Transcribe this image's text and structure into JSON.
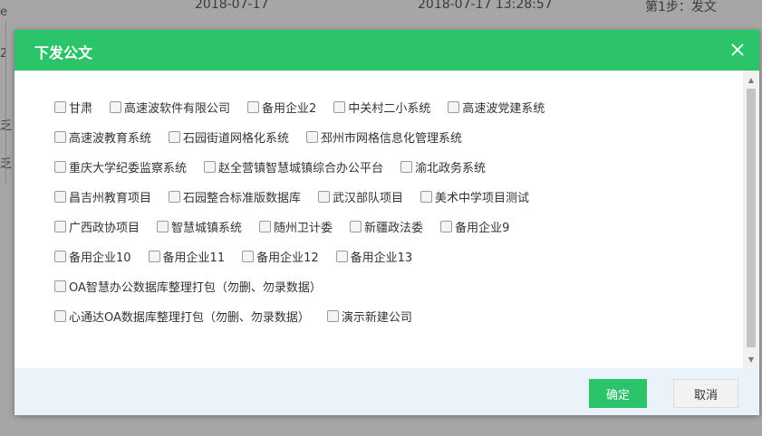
{
  "background": {
    "row": [
      "2018-07-17",
      "2018-07-17 13:28:57",
      "第1步：发文"
    ],
    "left_edge_chars": [
      "e",
      "2",
      "乏",
      "乏"
    ]
  },
  "dialog": {
    "title": "下发公文",
    "confirm_label": "确定",
    "cancel_label": "取消",
    "option_rows": [
      [
        "甘肃",
        "高速波软件有限公司",
        "备用企业2",
        "中关村二小系统",
        "高速波党建系统"
      ],
      [
        "高速波教育系统",
        "石园街道网格化系统",
        "邳州市网格信息化管理系统"
      ],
      [
        "重庆大学纪委监察系统",
        "赵全营镇智慧城镇综合办公平台",
        "渝北政务系统"
      ],
      [
        "昌吉州教育项目",
        "石园整合标准版数据库",
        "武汉部队项目",
        "美术中学项目测试"
      ],
      [
        "广西政协项目",
        "智慧城镇系统",
        "随州卫计委",
        "新疆政法委",
        "备用企业9"
      ],
      [
        "备用企业10",
        "备用企业11",
        "备用企业12",
        "备用企业13"
      ],
      [
        "OA智慧办公数据库整理打包（勿删、勿录数据）"
      ],
      [
        "心通达OA数据库整理打包（勿删、勿录数据）",
        "演示新建公司"
      ]
    ]
  },
  "colors": {
    "accent": "#2bc46b",
    "footer_bg": "#eaf3f9",
    "overlay": "#a6a6a6"
  }
}
